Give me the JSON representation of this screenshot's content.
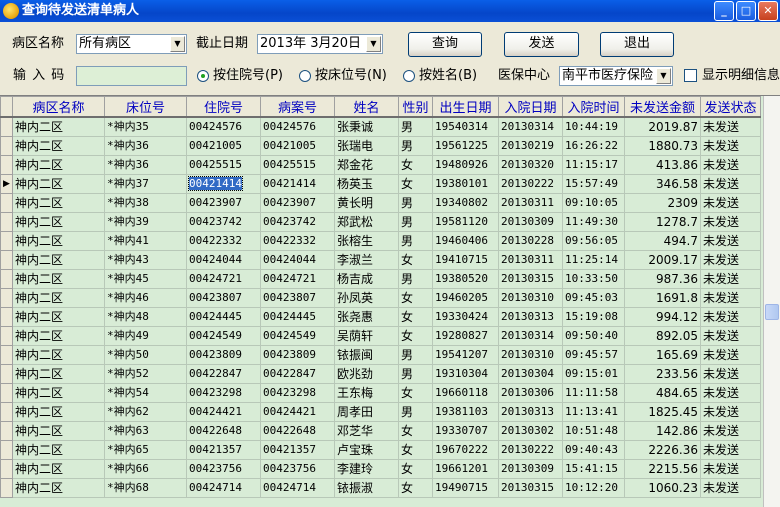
{
  "window": {
    "title": "查询待发送清单病人",
    "min": "_",
    "max": "□",
    "close": "✕"
  },
  "filters": {
    "ward_label": "病区名称",
    "ward_value": "所有病区",
    "date_label": "截止日期",
    "date_value": "2013年 3月20日",
    "input_label": "输 入 码",
    "input_value": "",
    "radio_inpatient": "按住院号(P)",
    "radio_bed": "按床位号(N)",
    "radio_name": "按姓名(B)",
    "insurance_label": "医保中心",
    "insurance_value": "南平市医疗保险",
    "show_detail": "显示明细信息"
  },
  "buttons": {
    "query": "查询",
    "send": "发送",
    "exit": "退出"
  },
  "grid": {
    "columns": [
      "病区名称",
      "床位号",
      "住院号",
      "病案号",
      "姓名",
      "性别",
      "出生日期",
      "入院日期",
      "入院时间",
      "未发送金额",
      "发送状态"
    ],
    "current_row": 3,
    "rows": [
      [
        "神内二区",
        "*神内35",
        "00424576",
        "00424576",
        "张秉诚",
        "男",
        "19540314",
        "20130314",
        "10:44:19",
        "2019.87",
        "未发送"
      ],
      [
        "神内二区",
        "*神内36",
        "00421005",
        "00421005",
        "张瑞电",
        "男",
        "19561225",
        "20130219",
        "16:26:22",
        "1880.73",
        "未发送"
      ],
      [
        "神内二区",
        "*神内36",
        "00425515",
        "00425515",
        "郑金花",
        "女",
        "19480926",
        "20130320",
        "11:15:17",
        "413.86",
        "未发送"
      ],
      [
        "神内二区",
        "*神内37",
        "00421414",
        "00421414",
        "杨英玉",
        "女",
        "19380101",
        "20130222",
        "15:57:49",
        "346.58",
        "未发送"
      ],
      [
        "神内二区",
        "*神内38",
        "00423907",
        "00423907",
        "黄长明",
        "男",
        "19340802",
        "20130311",
        "09:10:05",
        "2309",
        "未发送"
      ],
      [
        "神内二区",
        "*神内39",
        "00423742",
        "00423742",
        "郑武松",
        "男",
        "19581120",
        "20130309",
        "11:49:30",
        "1278.7",
        "未发送"
      ],
      [
        "神内二区",
        "*神内41",
        "00422332",
        "00422332",
        "张榕生",
        "男",
        "19460406",
        "20130228",
        "09:56:05",
        "494.7",
        "未发送"
      ],
      [
        "神内二区",
        "*神内43",
        "00424044",
        "00424044",
        "李淑兰",
        "女",
        "19410715",
        "20130311",
        "11:25:14",
        "2009.17",
        "未发送"
      ],
      [
        "神内二区",
        "*神内45",
        "00424721",
        "00424721",
        "杨吉成",
        "男",
        "19380520",
        "20130315",
        "10:33:50",
        "987.36",
        "未发送"
      ],
      [
        "神内二区",
        "*神内46",
        "00423807",
        "00423807",
        "孙凤英",
        "女",
        "19460205",
        "20130310",
        "09:45:03",
        "1691.8",
        "未发送"
      ],
      [
        "神内二区",
        "*神内48",
        "00424445",
        "00424445",
        "张尧惠",
        "女",
        "19330424",
        "20130313",
        "15:19:08",
        "994.12",
        "未发送"
      ],
      [
        "神内二区",
        "*神内49",
        "00424549",
        "00424549",
        "吴荫轩",
        "女",
        "19280827",
        "20130314",
        "09:50:40",
        "892.05",
        "未发送"
      ],
      [
        "神内二区",
        "*神内50",
        "00423809",
        "00423809",
        "铱振闽",
        "男",
        "19541207",
        "20130310",
        "09:45:57",
        "165.69",
        "未发送"
      ],
      [
        "神内二区",
        "*神内52",
        "00422847",
        "00422847",
        "欧兆劲",
        "男",
        "19310304",
        "20130304",
        "09:15:01",
        "233.56",
        "未发送"
      ],
      [
        "神内二区",
        "*神内54",
        "00423298",
        "00423298",
        "王东梅",
        "女",
        "19660118",
        "20130306",
        "11:11:58",
        "484.65",
        "未发送"
      ],
      [
        "神内二区",
        "*神内62",
        "00424421",
        "00424421",
        "周孝田",
        "男",
        "19381103",
        "20130313",
        "11:13:41",
        "1825.45",
        "未发送"
      ],
      [
        "神内二区",
        "*神内63",
        "00422648",
        "00422648",
        "邓芝华",
        "女",
        "19330707",
        "20130302",
        "10:51:48",
        "142.86",
        "未发送"
      ],
      [
        "神内二区",
        "*神内65",
        "00421357",
        "00421357",
        "卢宝珠",
        "女",
        "19670222",
        "20130222",
        "09:40:43",
        "2226.36",
        "未发送"
      ],
      [
        "神内二区",
        "*神内66",
        "00423756",
        "00423756",
        "李建玲",
        "女",
        "19661201",
        "20130309",
        "15:41:15",
        "2215.56",
        "未发送"
      ],
      [
        "神内二区",
        "*神内68",
        "00424714",
        "00424714",
        "铱振淑",
        "女",
        "19490715",
        "20130315",
        "10:12:20",
        "1060.23",
        "未发送"
      ]
    ]
  }
}
